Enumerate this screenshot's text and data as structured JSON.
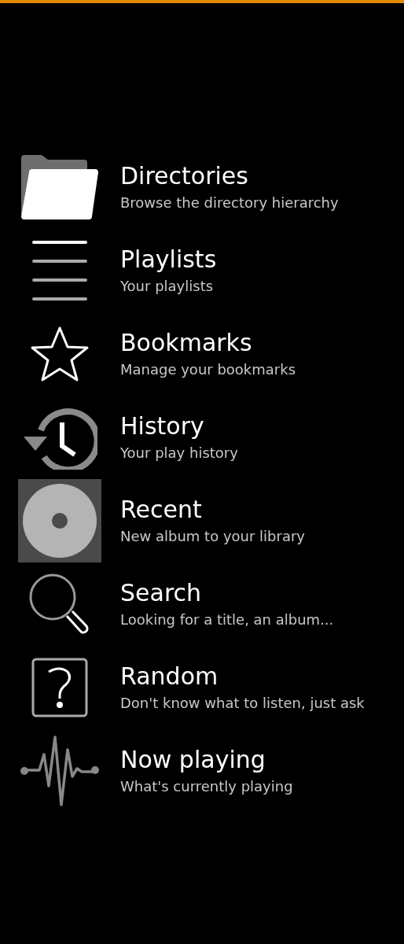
{
  "menu": [
    {
      "kind": "folder",
      "title": "Directories",
      "subtitle": "Browse the directory hierarchy"
    },
    {
      "kind": "lines",
      "title": "Playlists",
      "subtitle": "Your playlists"
    },
    {
      "kind": "star",
      "title": "Bookmarks",
      "subtitle": "Manage your bookmarks"
    },
    {
      "kind": "history",
      "title": "History",
      "subtitle": "Your play history"
    },
    {
      "kind": "disc",
      "title": "Recent",
      "subtitle": "New album to your library"
    },
    {
      "kind": "search",
      "title": "Search",
      "subtitle": "Looking for a title, an album..."
    },
    {
      "kind": "question",
      "title": "Random",
      "subtitle": "Don't know what to listen, just ask"
    },
    {
      "kind": "pulse",
      "title": "Now playing",
      "subtitle": "What's currently playing"
    }
  ]
}
